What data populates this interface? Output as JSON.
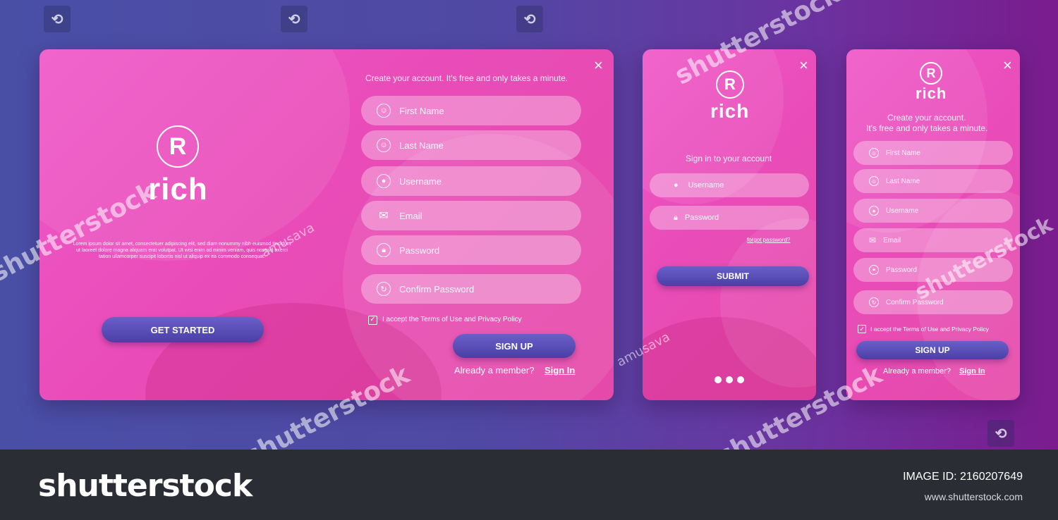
{
  "brand": {
    "mark": "R",
    "name": "rich"
  },
  "desktop": {
    "close": "×",
    "tagline": "Create your account. It's free and only takes a minute.",
    "lorem": "Lorem ipsum dolor sit amet, consectetuer adipiscing elit, sed diam nonummy nibh euismod tincidunt ut laoreet dolore magna aliquam erat volutpat. Ut wisi enim ad minim veniam, quis nostrud exerci tation ullamcorper suscipit lobortis nisl ut aliquip ex ea commodo consequat.",
    "get_started": "GET STARTED",
    "fields": {
      "first_name": "First Name",
      "last_name": "Last Name",
      "username": "Username",
      "email": "Email",
      "password": "Password",
      "confirm_password": "Confirm Password"
    },
    "terms": "I accept the Terms of Use and Privacy Policy",
    "signup": "SIGN UP",
    "already": "Already a member?",
    "signin": "Sign In"
  },
  "mobile_login": {
    "close": "×",
    "heading": "Sign in to your account",
    "username": "Username",
    "password": "Password",
    "forgot": "forgot password?",
    "submit": "SUBMIT"
  },
  "mobile_signup": {
    "close": "×",
    "tagline_1": "Create your account.",
    "tagline_2": "It's free and only takes a minute.",
    "fields": {
      "first_name": "First Name",
      "last_name": "Last Name",
      "username": "Username",
      "email": "Email",
      "password": "Password",
      "confirm_password": "Confirm Password"
    },
    "terms": "I accept the Terms of Use and Privacy Policy",
    "signup": "SIGN UP",
    "already": "Already a member?",
    "signin": "Sign In"
  },
  "watermark": {
    "word": "shutterstock",
    "author": "amusava"
  },
  "footer": {
    "logo": "shutterstock",
    "image_id": "IMAGE ID: 2160207649",
    "url": "www.shutterstock.com"
  },
  "colors": {
    "card_pink": "#e94cb8",
    "button_indigo": "#4b3fa6",
    "footer_bg": "#2b2d35"
  }
}
